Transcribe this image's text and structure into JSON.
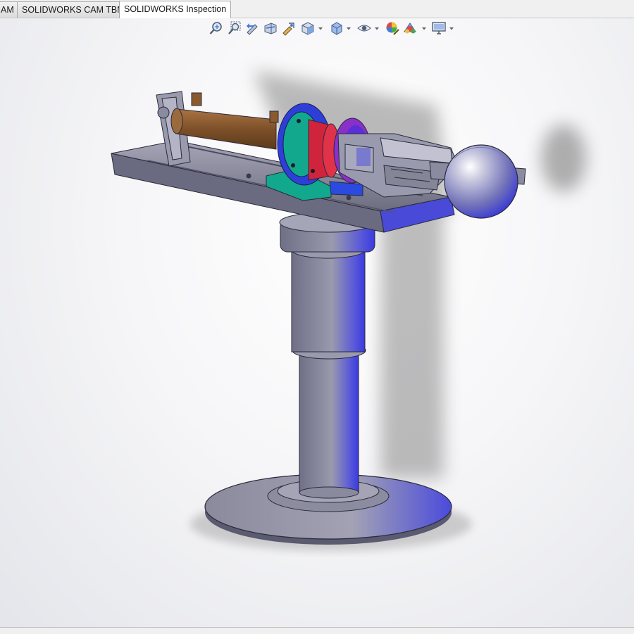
{
  "tabs": [
    {
      "label": "AM",
      "active": false
    },
    {
      "label": "SOLIDWORKS CAM TBM",
      "active": false
    },
    {
      "label": "SOLIDWORKS Inspection",
      "active": true
    }
  ],
  "heads_up_toolbar": [
    "zoom-to-fit-icon",
    "zoom-to-area-icon",
    "previous-view-icon",
    "section-view-icon",
    "dynamic-annotation-icon",
    "view-orientation-icon",
    "display-style-icon",
    "hide-show-items-icon",
    "edit-appearance-icon",
    "apply-scene-icon",
    "view-settings-icon"
  ],
  "colors": {
    "cylinder": "#8a5a2e",
    "flange": "#2e3fd8",
    "teal_bracket": "#12a88e",
    "red_housing": "#d0243c",
    "magenta_disc": "#8a30c8",
    "steel": "#7e7e92"
  }
}
